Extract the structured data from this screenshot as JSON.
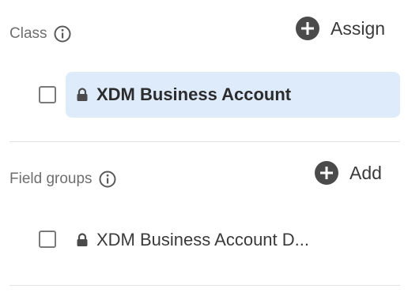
{
  "class_section": {
    "label": "Class",
    "info_icon": "info-icon",
    "assign_label": "Assign",
    "item": {
      "name": "XDM Business Account",
      "selected": true,
      "locked": true
    }
  },
  "field_groups_section": {
    "label": "Field groups",
    "info_icon": "info-icon",
    "add_label": "Add",
    "item": {
      "name": "XDM Business Account D...",
      "selected": false,
      "locked": true
    }
  },
  "colors": {
    "selected_row_bg": "#deebfb",
    "icon_dark": "#4b4b4b",
    "label_gray": "#6e6e6e"
  }
}
